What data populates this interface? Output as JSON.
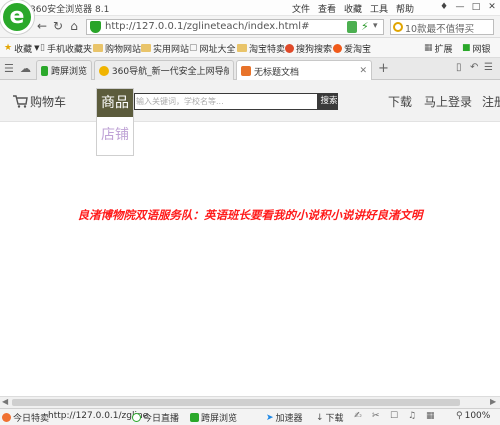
{
  "window": {
    "title": "360安全浏览器 8.1",
    "menu": [
      "文件",
      "查看",
      "收藏",
      "工具",
      "帮助"
    ],
    "controls": [
      "—",
      "□",
      "✕"
    ]
  },
  "address_bar": {
    "url": "http://127.0.0.1/zglineteach/index.html#",
    "search_placeholder": "10款最不值得买"
  },
  "bookmarks": {
    "items": [
      "收藏",
      "手机收藏夹",
      "购物网站",
      "实用网站",
      "网址大全",
      "淘宝特卖",
      "搜狗搜索",
      "爱淘宝"
    ],
    "right": [
      "扩展",
      "网银"
    ]
  },
  "tabs": [
    {
      "label": "跨屏浏览",
      "active": false
    },
    {
      "label": "360导航_新一代安全上网导航",
      "active": false
    },
    {
      "label": "无标题文档",
      "active": true
    }
  ],
  "page": {
    "cart": "购物车",
    "categories": [
      "商品",
      "店铺"
    ],
    "search_placeholder": "输入关键词，学校名等...",
    "search_button": "搜索",
    "nav_links": [
      "下载",
      "马上登录",
      "注册"
    ],
    "banner": "良渚博物院双语服务队：英语班长要看我的小说积小说讲好良渚文明"
  },
  "status_bar": {
    "items": [
      "今日特卖",
      "http://127.0.0.1/zgline",
      "今日直播",
      "跨屏浏览",
      "加速器",
      "下载",
      "",
      "",
      ""
    ],
    "zoom": "100%"
  },
  "colors": {
    "accent_green": "#2aa82a",
    "banner_red": "#ff1a1a",
    "category_bg": "#5c5c3c"
  }
}
